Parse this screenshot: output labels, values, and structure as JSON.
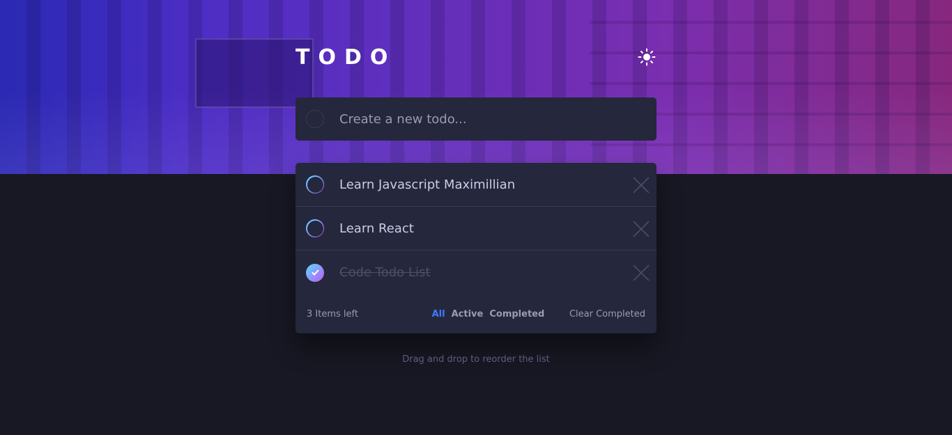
{
  "app": {
    "title": "TODO",
    "theme_icon": "sun-icon"
  },
  "new_todo": {
    "placeholder": "Create a new todo..."
  },
  "todos": [
    {
      "text": "Learn Javascript Maximillian",
      "completed": false
    },
    {
      "text": "Learn React",
      "completed": false
    },
    {
      "text": "Code Todo List",
      "completed": true
    }
  ],
  "footer": {
    "items_left": "3 Items left",
    "filters": [
      "All",
      "Active",
      "Completed"
    ],
    "active_filter": "All",
    "clear_label": "Clear Completed"
  },
  "hint": "Drag and drop to reorder the list",
  "colors": {
    "accent": "#3a7cfd",
    "check_gradient_start": "#57ddff",
    "check_gradient_end": "#c058f3",
    "card": "#25273c",
    "background": "#181824"
  }
}
